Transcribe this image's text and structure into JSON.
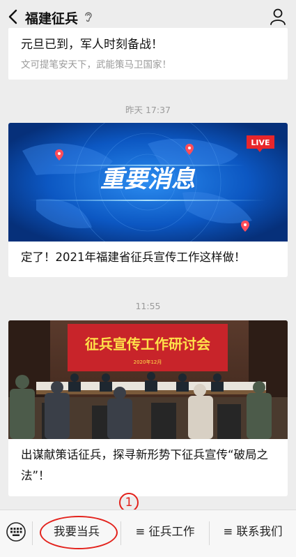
{
  "header": {
    "title": "福建征兵"
  },
  "feed": {
    "first": {
      "line1": "元旦已到，军人时刻备战！",
      "line2": "文可提笔安天下，武能策马卫国家！"
    },
    "time1": "昨天 17:37",
    "article1": {
      "banner_text": "重要消息",
      "live_badge": "LIVE",
      "caption": "定了！2021年福建省征兵宣传工作这样做！"
    },
    "time2": "11:55",
    "article2": {
      "banner_text": "征兵宣传工作研讨会",
      "banner_date": "2020年12月",
      "caption": "出谋献策话征兵，探寻新形势下征兵宣传“破局之法”！"
    }
  },
  "bottom_menu": {
    "item1": "我要当兵",
    "item2": "≡ 征兵工作",
    "item3": "≡ 联系我们"
  },
  "annotation": {
    "marker": "1"
  },
  "colors": {
    "accent_red": "#e3221c",
    "banner_blue": "#1560c6"
  }
}
